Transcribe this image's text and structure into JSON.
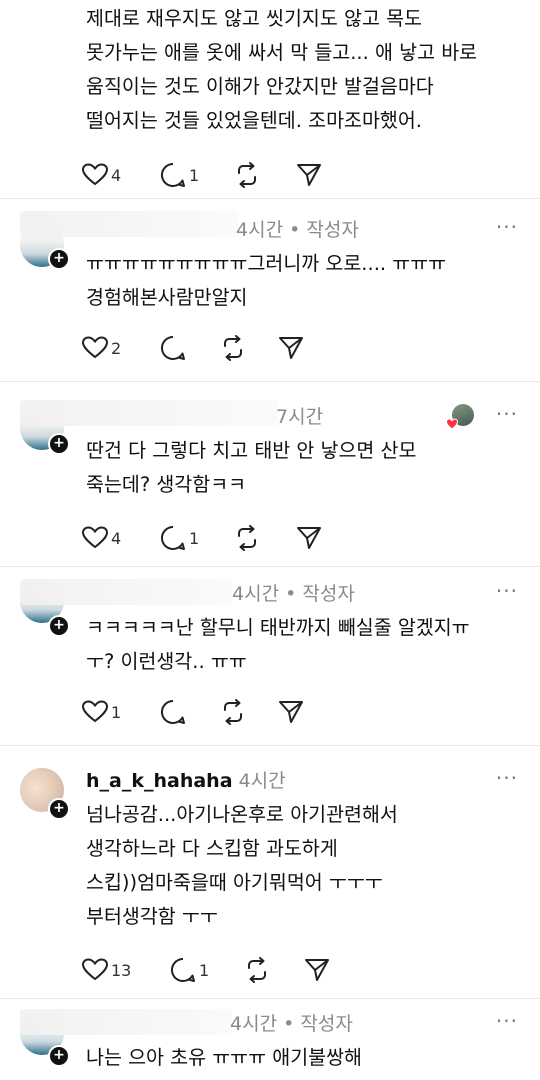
{
  "top_post": {
    "body": "제대로 재우지도 않고 씻기지도 않고 목도\n못가누는 애를 옷에 싸서 막 들고... 애 낳고 바로\n움직이는 것도 이해가 안갔지만 발걸음마다\n떨어지는 것들 있었을텐데. 조마조마했어.",
    "likes": "4",
    "replies": "1"
  },
  "comments": [
    {
      "username": "",
      "time": "4시간",
      "tag": "작성자",
      "separator": "•",
      "body": "ㅠㅠㅠㅠㅠㅠㅠㅠㅠ그러니까 오로.... ㅠㅠㅠ\n경험해본사람만알지",
      "likes": "2",
      "replies": ""
    },
    {
      "username": "",
      "time": "7시간",
      "tag": "",
      "separator": "",
      "body": "딴건 다 그렇다 치고 태반 안 낳으면 산모\n죽는데? 생각함ㅋㅋ",
      "likes": "4",
      "replies": "1"
    },
    {
      "username": "",
      "time": "4시간",
      "tag": "작성자",
      "separator": "•",
      "body": "ㅋㅋㅋㅋㅋ난 할무니 태반까지 빼실줄 알겠지ㅠ\nㅜ? 이런생각.. ㅠㅠ",
      "likes": "1",
      "replies": ""
    },
    {
      "username": "h_a_k_hahaha",
      "time": "4시간",
      "tag": "",
      "separator": "",
      "body": "넘나공감...아기나온후로 아기관련해서\n생각하느라 다 스킵함 과도하게\n스킵))엄마죽을때  아기뭐먹어 ㅜㅜㅜ\n부터생각함 ㅜㅜ",
      "likes": "13",
      "replies": "1"
    },
    {
      "username": "",
      "time": "4시간",
      "tag": "작성자",
      "separator": "•",
      "body": "나는 으아 초유 ㅠㅠㅠ 애기불쌍해",
      "likes": "",
      "replies": ""
    }
  ],
  "icons": {
    "like": "heart-icon",
    "reply": "comment-icon",
    "repost": "repost-icon",
    "share": "send-icon",
    "more": "more-icon",
    "follow": "plus-icon"
  },
  "more_glyph": "···",
  "follow_glyph": "+",
  "colors": {
    "meta": "#8a8a8a",
    "text": "#111111",
    "separator": "#e6e6e6"
  }
}
